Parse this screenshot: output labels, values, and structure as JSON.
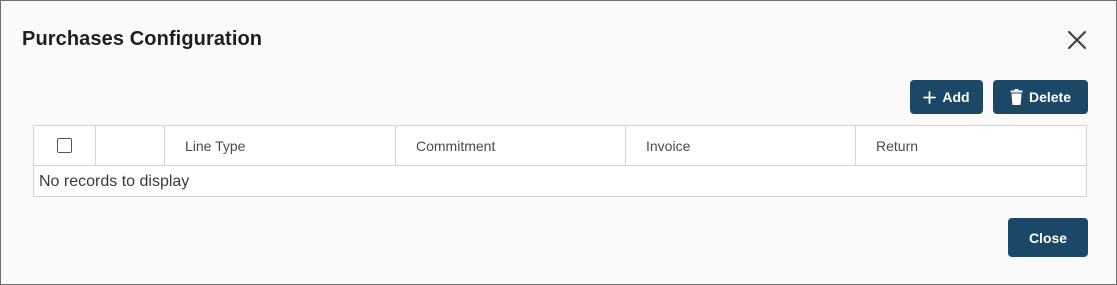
{
  "dialog": {
    "title": "Purchases Configuration"
  },
  "toolbar": {
    "add_label": "Add",
    "delete_label": "Delete"
  },
  "grid": {
    "columns": [
      "",
      "",
      "Line Type",
      "Commitment",
      "Invoice",
      "Return"
    ],
    "empty_message": "No records to display"
  },
  "footer": {
    "close_label": "Close"
  },
  "icons": {
    "close": "close-icon",
    "add": "plus-icon",
    "delete": "trash-icon"
  },
  "colors": {
    "primary_button": "#1a4866"
  }
}
